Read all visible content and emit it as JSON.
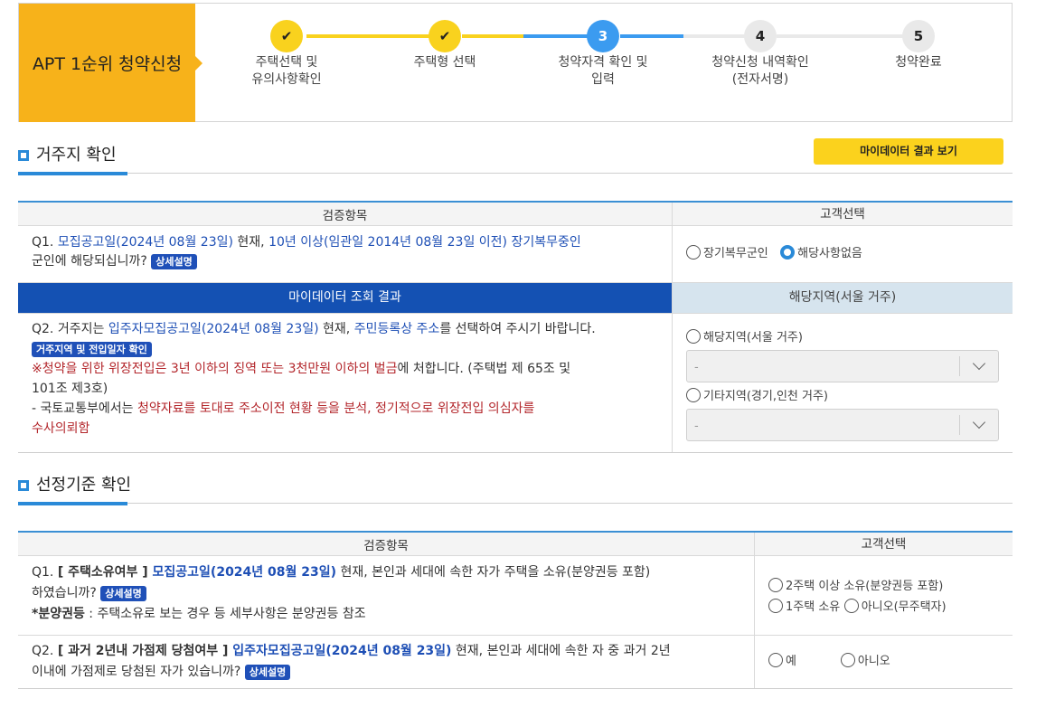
{
  "steps": {
    "title": "APT 1순위 청약신청",
    "items": [
      {
        "num": "✔",
        "line1": "주택선택 및",
        "line2": "유의사항확인"
      },
      {
        "num": "✔",
        "line1": "주택형 선택",
        "line2": ""
      },
      {
        "num": "3",
        "line1": "청약자격 확인 및",
        "line2": "입력"
      },
      {
        "num": "4",
        "line1": "청약신청 내역확인",
        "line2": "(전자서명)"
      },
      {
        "num": "5",
        "line1": "청약완료",
        "line2": ""
      }
    ]
  },
  "residence": {
    "heading": "거주지 확인",
    "mydata_button": "마이데이터 결과 보기",
    "col_item": "검증항목",
    "col_choice": "고객선택",
    "q1": {
      "prefix": "Q1. ",
      "notice_date": "모집공고일(2024년 08월 23일)",
      "t1": " 현재, ",
      "period": "10년 이상(임관일 2014년 08월 23일 이전) 장기복무중인",
      "t2": "군인에 해당되십니까?",
      "badge": "상세설명",
      "opt1": "장기복무군인",
      "opt2": "해당사항없음"
    },
    "mydata_row": {
      "left": "마이데이터 조회 결과",
      "right": "해당지역(서울 거주)"
    },
    "q2": {
      "prefix": "Q2. 거주지는 ",
      "notice_date": "입주자모집공고일(2024년 08월 23일)",
      "t1": " 현재, ",
      "addr": "주민등록상 주소",
      "t2": "를 선택하여 주시기 바랍니다.",
      "badge": "거주지역 및 전입일자 확인",
      "warn_red": "※청약을 위한 위장전입은 3년 이하의 징역 또는 3천만원 이하의 벌금",
      "warn_rest": "에 처합니다. (주택법 제 65조 및",
      "warn_line2": "101조 제3호)",
      "note_prefix": "- 국토교통부에서는 ",
      "note_red": "청약자료를 토대로 주소이전 현황 등을 분석, 정기적으로 위장전입 의심자를",
      "note_red2": "수사의뢰함",
      "opt1": "해당지역(서울 거주)",
      "select1": "-",
      "opt2": "기타지역(경기,인천 거주)",
      "select2": "-"
    }
  },
  "criteria": {
    "heading": "선정기준 확인",
    "col_item": "검증항목",
    "col_choice": "고객선택",
    "q1": {
      "prefix": "Q1. ",
      "bold": "[ 주택소유여부 ]",
      "notice": " 모집공고일(2024년 08월 23일)",
      "t1": " 현재, 본인과 세대에 속한 자가 주택을 소유(분양권등 포함)",
      "t2": "하였습니까?",
      "badge": "상세설명",
      "note_bold": "*분양권등",
      "note": " : 주택소유로 보는 경우 등 세부사항은 분양권등 참조",
      "opt1": "2주택 이상 소유(분양권등 포함)",
      "opt2": "1주택 소유",
      "opt3": "아니오(무주택자)"
    },
    "q2": {
      "prefix": "Q2. ",
      "bold": "[ 과거 2년내 가점제 당첨여부 ]",
      "notice": " 입주자모집공고일(2024년 08월 23일)",
      "t1": " 현재, 본인과 세대에 속한 자 중 과거 2년",
      "t2": "이내에 가점제로 당첨된 자가 있습니까?",
      "badge": "상세설명",
      "opt1": "예",
      "opt2": "아니오"
    }
  },
  "colors": {
    "accent": "#f7b21a",
    "blue": "#1f50b8",
    "link": "#2a8ad8",
    "warn": "#b3262b"
  }
}
